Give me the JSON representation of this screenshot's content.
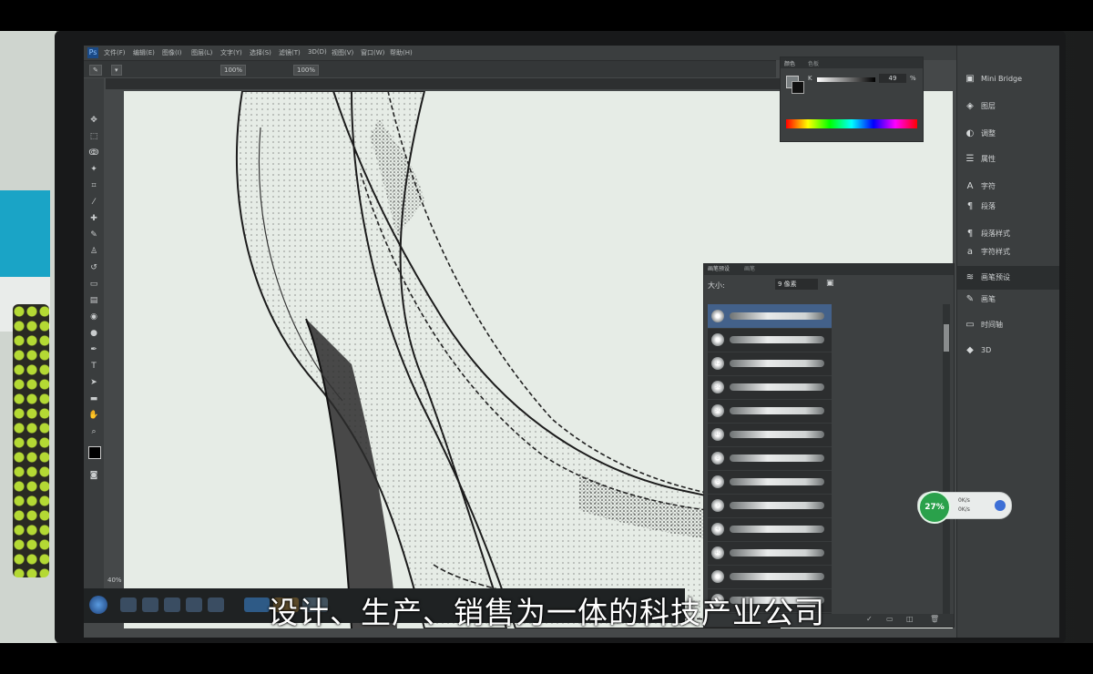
{
  "video": {
    "subtitle": "设计、生产、销售为一体的科技产业公司"
  },
  "photoshop": {
    "menu": [
      "文件(F)",
      "编辑(E)",
      "图像(I)",
      "图层(L)",
      "文字(Y)",
      "选择(S)",
      "滤镜(T)",
      "3D(D)",
      "视图(V)",
      "窗口(W)",
      "帮助(H)"
    ],
    "options": {
      "opacity": "100%",
      "flow": "100%"
    },
    "color_panel": {
      "tabs": [
        "颜色",
        "色板"
      ],
      "channel_label": "K",
      "value": "49",
      "unit": "%"
    },
    "brush_panel": {
      "tabs": [
        "画笔预设",
        "画笔"
      ],
      "size_label": "大小:",
      "size_value": "9 像素",
      "presets": [
        {
          "tip": ""
        },
        {
          "tip": ""
        },
        {
          "tip": "42"
        },
        {
          "tip": "50"
        },
        {
          "tip": "50"
        },
        {
          "tip": "40"
        },
        {
          "tip": "8"
        },
        {
          "tip": "6"
        },
        {
          "tip": "5"
        },
        {
          "tip": "4"
        },
        {
          "tip": "40"
        },
        {
          "tip": ""
        },
        {
          "tip": ""
        }
      ]
    },
    "dock": [
      {
        "icon": "mini-bridge-icon",
        "label": "Mini Bridge"
      },
      {
        "icon": "layers-icon",
        "label": "图层"
      },
      {
        "icon": "adjustments-icon",
        "label": "调整"
      },
      {
        "icon": "properties-icon",
        "label": "属性"
      },
      {
        "icon": "character-icon",
        "label": "字符"
      },
      {
        "icon": "paragraph-icon",
        "label": "段落"
      },
      {
        "icon": "paragraph-styles-icon",
        "label": "段落样式"
      },
      {
        "icon": "character-styles-icon",
        "label": "字符样式"
      },
      {
        "icon": "brush-presets-icon",
        "label": "画笔预设"
      },
      {
        "icon": "brush-icon",
        "label": "画笔"
      },
      {
        "icon": "timeline-icon",
        "label": "时间轴"
      },
      {
        "icon": "3d-icon",
        "label": "3D"
      }
    ],
    "status": {
      "zoom": "40%"
    }
  },
  "performance_widget": {
    "percent": "27%",
    "upload": "0K/s",
    "download": "0K/s"
  }
}
